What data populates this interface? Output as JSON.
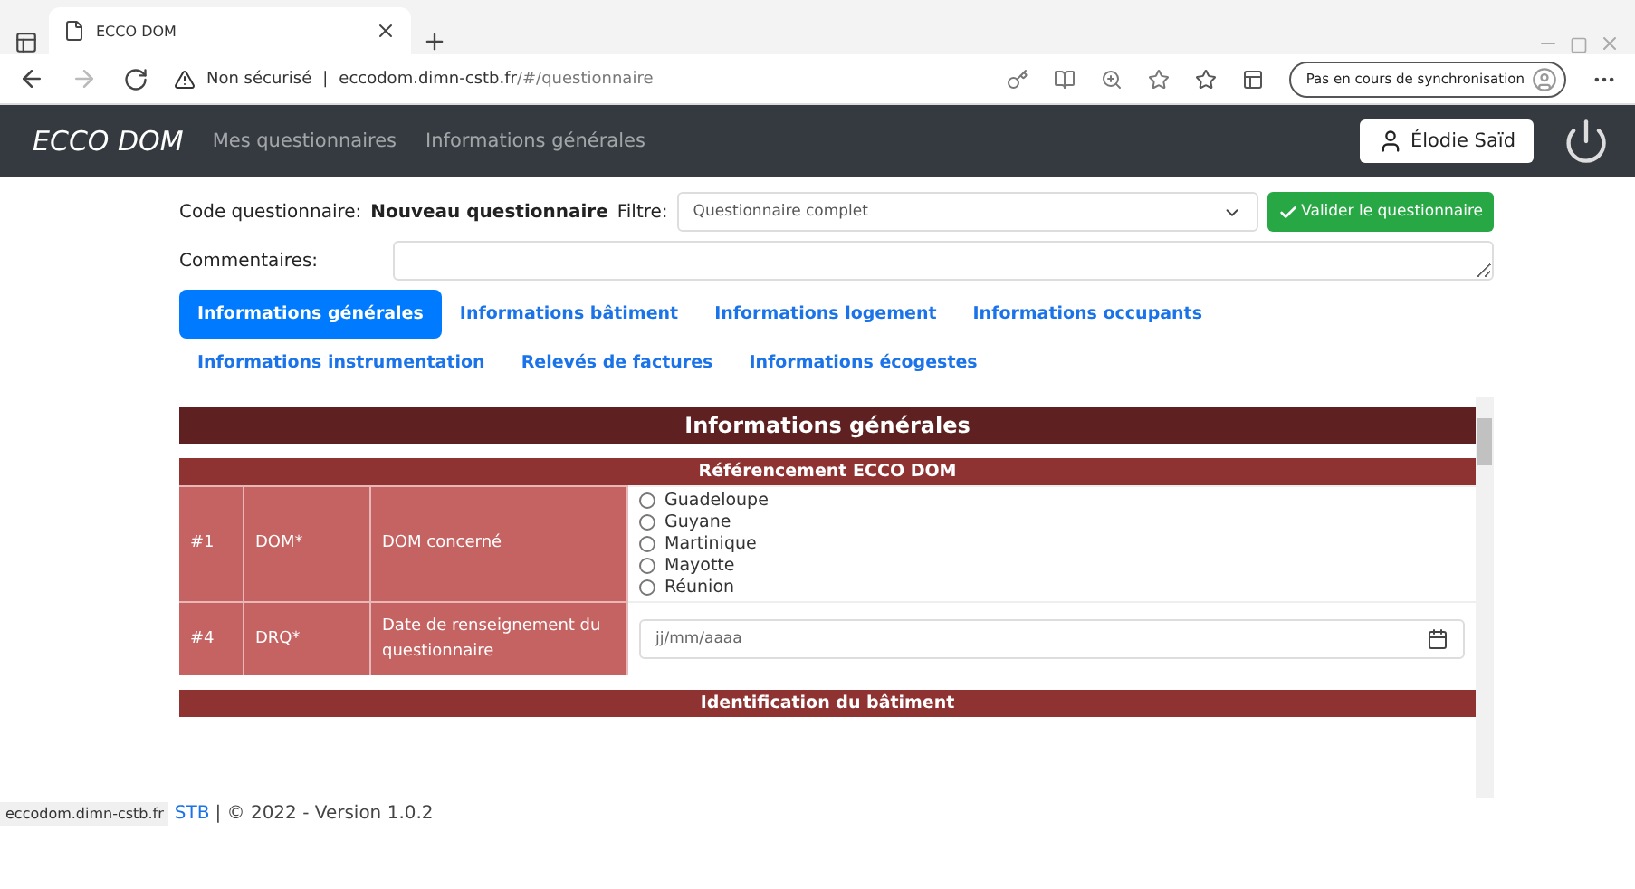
{
  "browser": {
    "tab_title": "ECCO DOM",
    "security": "Non sécurisé",
    "separator": "|",
    "url_host": "eccodom.dimn-cstb.fr",
    "url_path": "/#/questionnaire",
    "sync": "Pas en cours de synchronisation"
  },
  "navbar": {
    "brand": "ECCO DOM",
    "links": [
      "Mes questionnaires",
      "Informations générales"
    ],
    "user": "Élodie Saïd"
  },
  "header": {
    "code_label": "Code questionnaire:",
    "code_value": "Nouveau questionnaire",
    "filter_label": "Filtre:",
    "filter_value": "Questionnaire complet",
    "validate_button": "Valider le questionnaire",
    "comments_label": "Commentaires:"
  },
  "tabs": [
    {
      "label": "Informations générales",
      "selected": true
    },
    {
      "label": "Informations bâtiment",
      "selected": false
    },
    {
      "label": "Informations logement",
      "selected": false
    },
    {
      "label": "Informations occupants",
      "selected": false
    },
    {
      "label": "Informations instrumentation",
      "selected": false
    },
    {
      "label": "Relevés de factures",
      "selected": false
    },
    {
      "label": "Informations écogestes",
      "selected": false
    }
  ],
  "section": {
    "title": "Informations générales",
    "groups": [
      {
        "title": "Référencement ECCO DOM",
        "rows": [
          {
            "number": "#1",
            "code": "DOM*",
            "label": "DOM concerné",
            "kind": "radio",
            "options": [
              {
                "label": "Guadeloupe",
                "selected": false
              },
              {
                "label": "Guyane",
                "selected": false
              },
              {
                "label": "Martinique",
                "selected": false
              },
              {
                "label": "Mayotte",
                "selected": false
              },
              {
                "label": "Réunion",
                "selected": false
              }
            ]
          },
          {
            "number": "#4",
            "code": "DRQ*",
            "label": "Date de renseignement du questionnaire",
            "kind": "date",
            "placeholder": "jj/mm/aaaa"
          }
        ]
      },
      {
        "title": "Identification du bâtiment"
      }
    ]
  },
  "status_url": "eccodom.dimn-cstb.fr",
  "footer": {
    "link": "STB",
    "text": "| © 2022 - Version 1.0.2"
  }
}
